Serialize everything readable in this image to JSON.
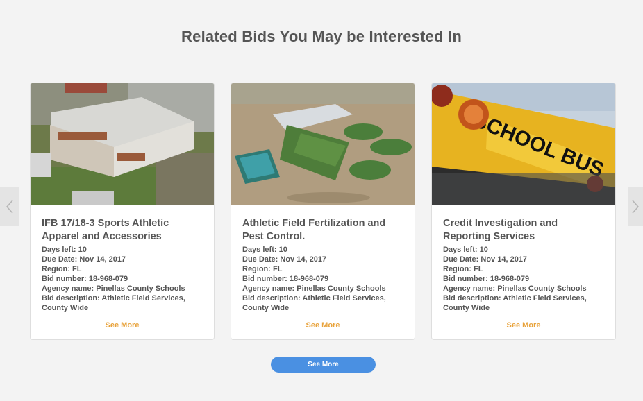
{
  "section": {
    "title": "Related Bids You May be Interested In",
    "see_more_button": "See More"
  },
  "cards": [
    {
      "title": "IFB 17/18-3 Sports Athletic Apparel and Accessories",
      "image": "school-building-aerial",
      "days_left": "Days left: 10",
      "due_date": "Due Date: Nov 14, 2017",
      "region": "Region: FL",
      "bid_number": "Bid number: 18-968-079",
      "agency": "Agency name: Pinellas County Schools",
      "description": "Bid description: Athletic Field Services, County Wide",
      "link": "See More"
    },
    {
      "title": "Athletic Field Fertilization and Pest Control.",
      "image": "athletic-fields-aerial",
      "days_left": "Days left: 10",
      "due_date": "Due Date: Nov 14, 2017",
      "region": "Region: FL",
      "bid_number": "Bid number: 18-968-079",
      "agency": "Agency name: Pinellas County Schools",
      "description": "Bid description: Athletic Field Services, County Wide",
      "link": "See More"
    },
    {
      "title": "Credit Investigation and Reporting Services",
      "image": "school-bus",
      "image_text": "SCHOOL BUS",
      "days_left": "Days left: 10",
      "due_date": "Due Date: Nov 14, 2017",
      "region": "Region: FL",
      "bid_number": "Bid number: 18-968-079",
      "agency": "Agency name: Pinellas County Schools",
      "description": "Bid description: Athletic Field Services, County Wide",
      "link": "See More"
    }
  ],
  "nav": {
    "prev_icon": "chevron-left-icon",
    "next_icon": "chevron-right-icon"
  },
  "colors": {
    "link": "#e8a23a",
    "button": "#4a90e2",
    "text": "#555555"
  }
}
